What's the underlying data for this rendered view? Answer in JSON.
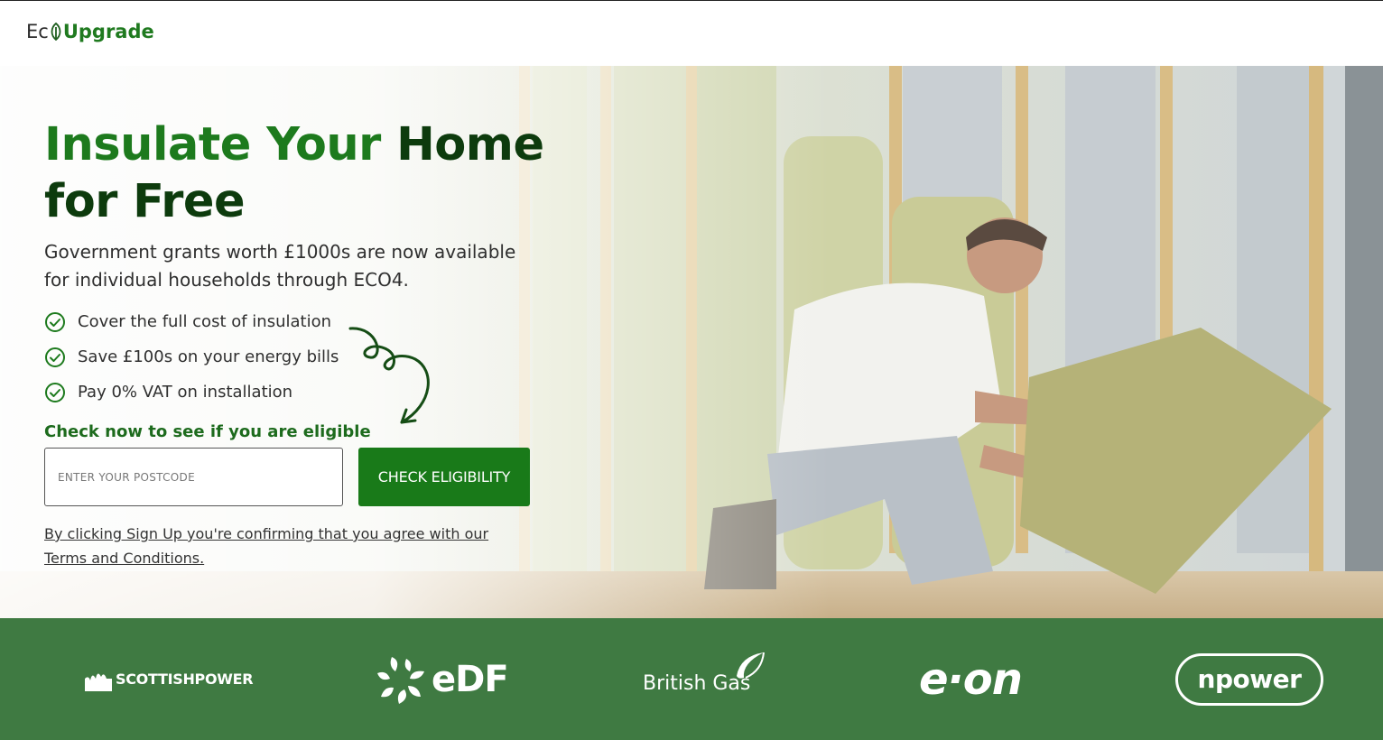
{
  "header": {
    "logo_eco": "Ec",
    "logo_upgrade": "Upgrade"
  },
  "hero": {
    "headline_part1": "Insulate Your",
    "headline_part2": "Home",
    "headline_part3": "for Free",
    "subtitle": "Government grants worth £1000s are now available for individual households through ECO4.",
    "benefits": [
      "Cover the full cost of insulation",
      "Save £100s on your energy bills",
      "Pay 0% VAT on installation"
    ],
    "cta_label": "Check now to see if you are eligible",
    "postcode_placeholder": "ENTER YOUR POSTCODE",
    "postcode_value": "",
    "button_label": "CHECK ELIGIBILITY",
    "terms_text": "By clicking Sign Up you're confirming that you agree with our Terms and Conditions."
  },
  "partners": {
    "scottishpower": "SCOTTISHPOWER",
    "edf": "eDF",
    "british_gas": "British Gas",
    "eon": "e·on",
    "npower": "npower"
  },
  "colors": {
    "brand_green": "#1d7a1d",
    "dark_green": "#0d3b0d",
    "button_green": "#197a19",
    "partner_bar": "#3f7a42"
  },
  "icons": {
    "benefit_icon": "check-circle-icon",
    "arrow_icon": "curly-arrow-icon",
    "logo_icon": "leaf-icon"
  }
}
